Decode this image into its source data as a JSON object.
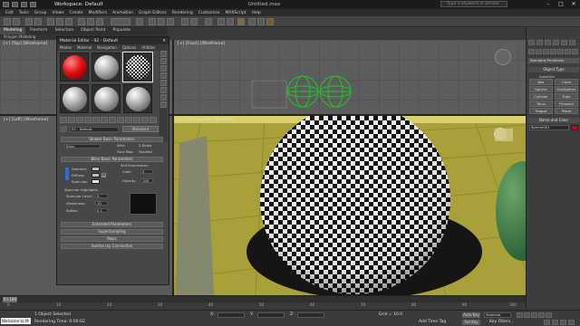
{
  "app": {
    "title": "Workspace: Default",
    "file_name": "Untitled.max",
    "search_placeholder": "Type a keyword or phrase",
    "window_controls": [
      "–",
      "□",
      "✕"
    ]
  },
  "menubar": [
    "Edit",
    "Tools",
    "Group",
    "Views",
    "Create",
    "Modifiers",
    "Animation",
    "Graph Editors",
    "Rendering",
    "Customize",
    "MAXScript",
    "Help"
  ],
  "ribbon": {
    "tabs": [
      "Modeling",
      "Freeform",
      "Selection",
      "Object Paint",
      "Populate"
    ],
    "active": "Modeling",
    "sub_label": "Polygon Modeling"
  },
  "viewports": {
    "top": "[+] [Top] [Wireframe]",
    "left": "[+] [Left] [Wireframe]",
    "front": "[+] [Front] [Wireframe]",
    "persp": "[+] [Perspective] [Realistic]"
  },
  "material_editor": {
    "title": "Material Editor - 02 - Default",
    "menu": [
      "Modes",
      "Material",
      "Navigation",
      "Options",
      "Utilities"
    ],
    "material_name": "02 - Default",
    "material_type": "Standard",
    "rollouts": {
      "shader_basic": "Shader Basic Parameters",
      "blinn_basic": "Blinn Basic Parameters",
      "specular_highlights": "Specular Highlights",
      "extended": "Extended Parameters",
      "supersampling": "SuperSampling",
      "maps": "Maps",
      "mental_ray": "mental ray Connection"
    },
    "shader": "Blinn",
    "checkboxes": [
      "Wire",
      "2-Sided",
      "Face Map",
      "Faceted"
    ],
    "self_illum_label": "Self-Illumination",
    "color_label": "Color",
    "opacity_label": "Opacity",
    "color_rows": [
      "Ambient:",
      "Diffuse:",
      "Specular:"
    ],
    "highlights": [
      {
        "label": "Specular Level:",
        "value": "0"
      },
      {
        "label": "Glossiness:",
        "value": "10"
      },
      {
        "label": "Soften:",
        "value": "0.1"
      }
    ],
    "self_illum_value": "0",
    "opacity_value": "100",
    "slots": [
      {
        "kind": "red"
      },
      {
        "kind": "gray"
      },
      {
        "kind": "checker"
      },
      {
        "kind": "gray"
      },
      {
        "kind": "gray"
      },
      {
        "kind": "gray"
      }
    ]
  },
  "command_panel": {
    "dropdown": "Standard Primitives",
    "object_type": "Object Type",
    "autogrid": "AutoGrid",
    "buttons": [
      "Box",
      "Cone",
      "Sphere",
      "GeoSphere",
      "Cylinder",
      "Tube",
      "Torus",
      "Pyramid",
      "Teapot",
      "Plane"
    ],
    "name_color": "Name and Color",
    "object_name": "Sphere001"
  },
  "timeline": {
    "frame": "0 / 100",
    "ticks": [
      "0",
      "10",
      "20",
      "30",
      "40",
      "50",
      "60",
      "70",
      "80",
      "90",
      "100"
    ]
  },
  "status": {
    "listener": "Welcome to M",
    "selection": "1 Object Selected",
    "prompt": "Rendering Time: 0:00:02",
    "x": "X:",
    "y": "Y:",
    "z": "Z:",
    "grid": "Grid = 10.0",
    "autokey": "Auto Key",
    "setkey": "Set Key",
    "key_mode": "Selected",
    "key_filters": "Key Filters...",
    "add_time_tag": "Add Time Tag"
  },
  "colors": {
    "floor": "#a8a13a",
    "red_ball": "#d81818",
    "wire_green": "#27c227"
  }
}
